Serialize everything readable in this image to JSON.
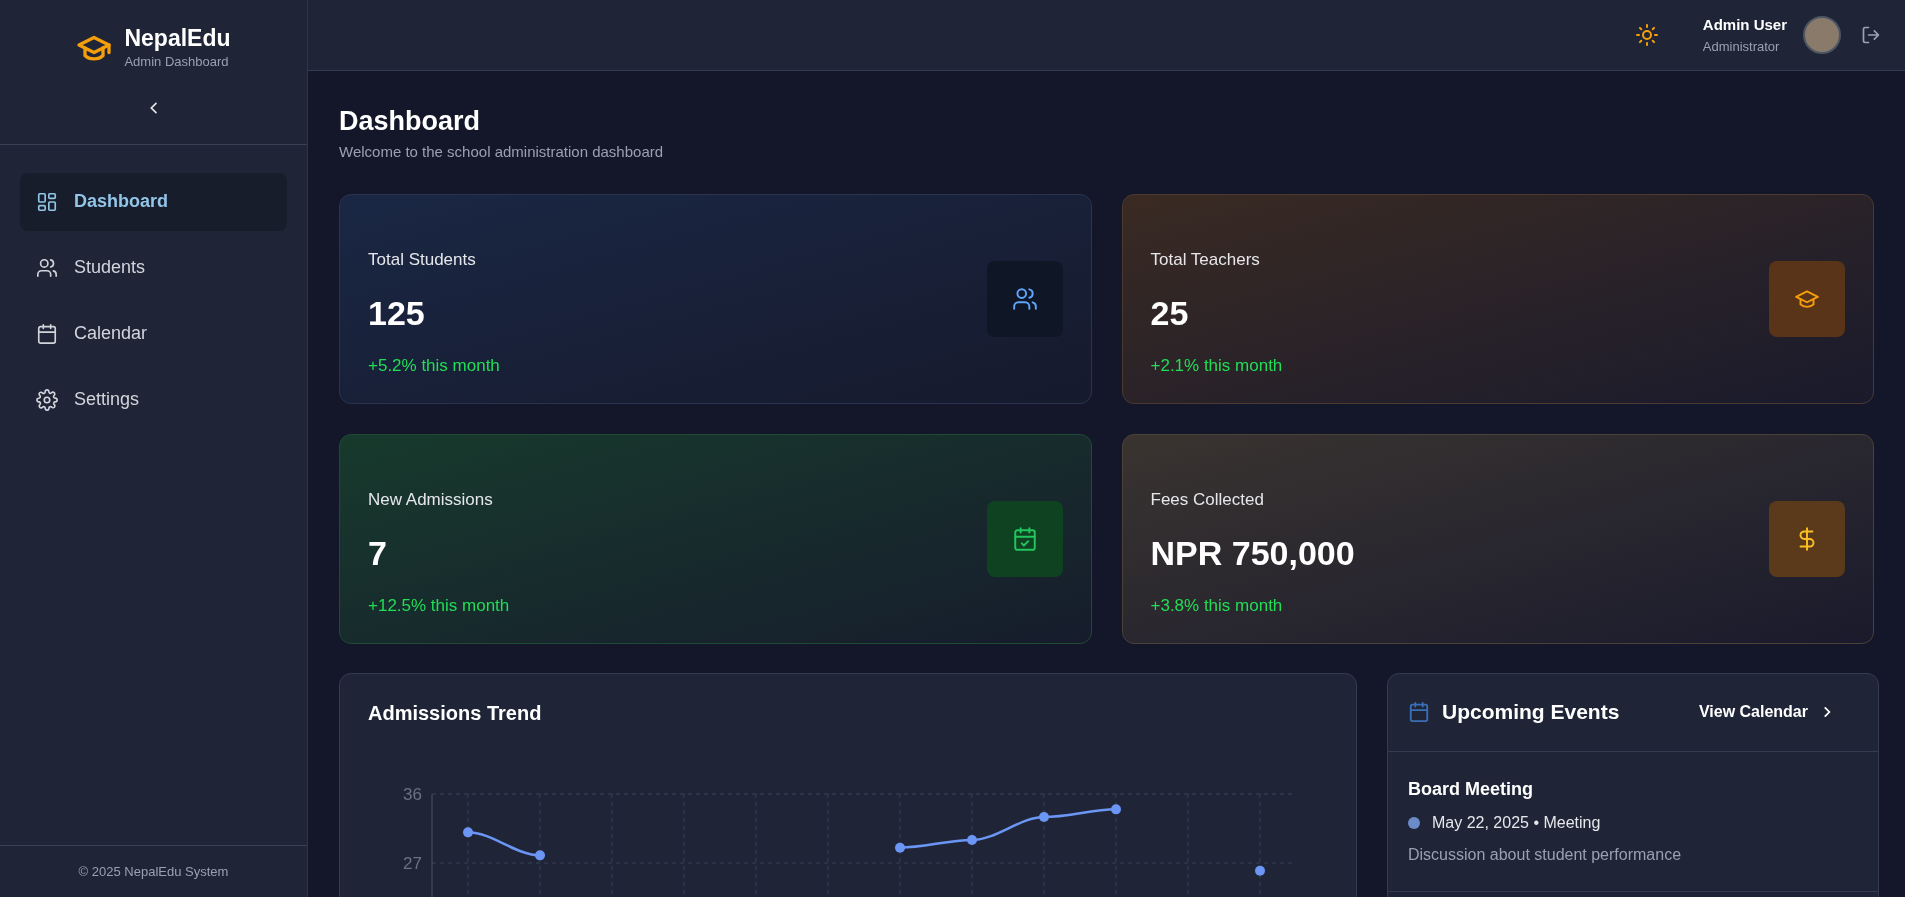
{
  "brand": {
    "name": "NepalEdu",
    "subtitle": "Admin Dashboard"
  },
  "sidebar": {
    "items": [
      {
        "label": "Dashboard",
        "selected": true
      },
      {
        "label": "Students",
        "selected": false
      },
      {
        "label": "Calendar",
        "selected": false
      },
      {
        "label": "Settings",
        "selected": false
      }
    ],
    "footer": "© 2025 NepalEdu System"
  },
  "header": {
    "user_name": "Admin User",
    "user_role": "Administrator"
  },
  "page": {
    "title": "Dashboard",
    "subtitle": "Welcome to the school administration dashboard"
  },
  "stats": [
    {
      "label": "Total Students",
      "value": "125",
      "change": "+5.2% this month",
      "color": "#60a5fa"
    },
    {
      "label": "Total Teachers",
      "value": "25",
      "change": "+2.1% this month",
      "color": "#f59e0b"
    },
    {
      "label": "New Admissions",
      "value": "7",
      "change": "+12.5% this month",
      "color": "#22c55e"
    },
    {
      "label": "Fees Collected",
      "value": "NPR 750,000",
      "change": "+3.8% this month",
      "color": "#fbbf24"
    }
  ],
  "admissions_trend": {
    "title": "Admissions Trend",
    "chart_data": {
      "type": "line",
      "grid": true,
      "categories": [
        null,
        null,
        null,
        null,
        null,
        null,
        null,
        null,
        null,
        null,
        null,
        null
      ],
      "ylim": [
        0,
        36
      ],
      "yticks": [
        27,
        36
      ],
      "series": [
        {
          "color": "#6b96f5",
          "marker": "circle",
          "values": [
            31,
            28,
            null,
            null,
            null,
            null,
            29,
            30,
            33,
            34,
            null,
            26
          ]
        }
      ]
    }
  },
  "events": {
    "title": "Upcoming Events",
    "link": "View Calendar",
    "items": [
      {
        "title": "Board Meeting",
        "meta": "May 22, 2025 • Meeting",
        "description": "Discussion about student performance",
        "color": "#6b8cc9"
      }
    ]
  }
}
